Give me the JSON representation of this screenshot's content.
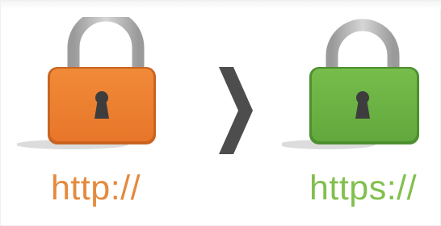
{
  "left": {
    "label": "http://",
    "state": "unlocked",
    "icon": "open-padlock-icon",
    "body_color": "#ec7a2a",
    "label_color": "#e58a3d"
  },
  "separator": {
    "icon": "chevron-right-icon",
    "color": "#4d4d4d"
  },
  "right": {
    "label": "https://",
    "state": "locked",
    "icon": "closed-padlock-icon",
    "body_color": "#6ab245",
    "label_color": "#82c04e"
  }
}
